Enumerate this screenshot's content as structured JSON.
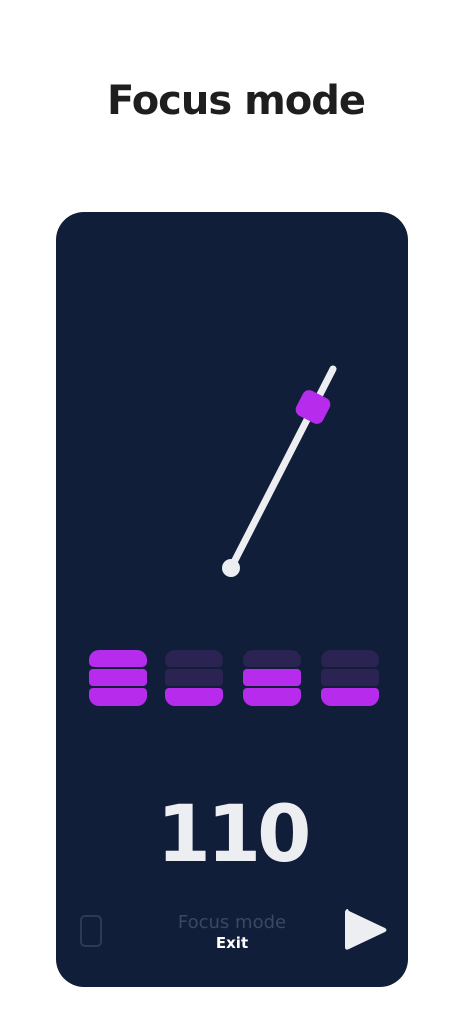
{
  "page": {
    "title": "Focus mode"
  },
  "metronome": {
    "tempo": "110",
    "accent_color": "#b72cec",
    "inactive_color": "#2b2452",
    "card_color": "#101e3a",
    "arm_color": "#eceef2",
    "weight_position_fraction": 0.83,
    "beats": [
      {
        "level": 3
      },
      {
        "level": 1
      },
      {
        "level": 2
      },
      {
        "level": 1
      }
    ]
  },
  "footer": {
    "mode_label": "Focus mode",
    "exit_label": "Exit",
    "left_icon": "phone-icon",
    "right_icon": "play-icon"
  }
}
